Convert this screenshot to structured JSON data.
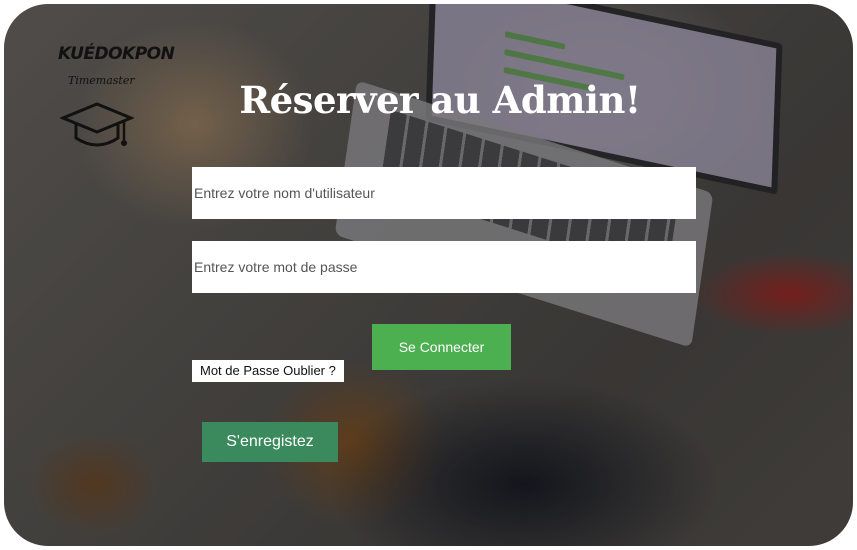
{
  "logo": {
    "brand": "KUÉDOKPON",
    "tagline": "Timemaster",
    "icon": "graduation-cap-icon"
  },
  "page": {
    "title": "Réserver au Admin!"
  },
  "form": {
    "username_placeholder": "Entrez votre nom d'utilisateur",
    "password_placeholder": "Entrez votre mot de passe",
    "connect_label": "Se Connecter",
    "forgot_label": "Mot de Passe Oublier ?",
    "register_label": "S'enregistez"
  },
  "colors": {
    "connect_button": "#4caf50",
    "register_button": "#3a8a5e"
  }
}
